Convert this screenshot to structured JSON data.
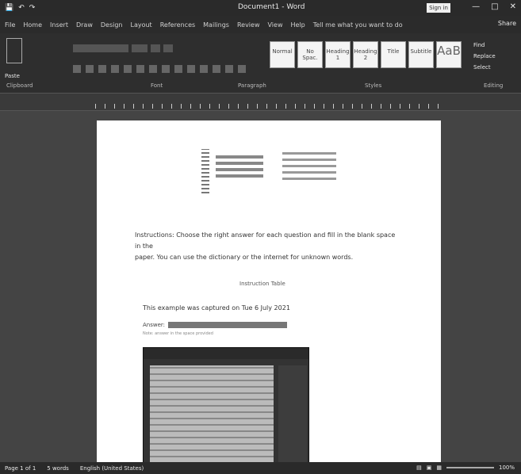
{
  "titlebar": {
    "qa_save": "save",
    "qa_undo": "↶",
    "qa_redo": "↷",
    "doc_title": "Document1 - Word",
    "signin": "Sign in",
    "min": "—",
    "max": "□",
    "close": "✕"
  },
  "menu": {
    "tabs": [
      "File",
      "Home",
      "Insert",
      "Draw",
      "Design",
      "Layout",
      "References",
      "Mailings",
      "Review",
      "View",
      "Help"
    ],
    "tell_me": "Tell me what you want to do",
    "share": "Share"
  },
  "ribbon": {
    "paste": "Paste",
    "clipboard": "Clipboard",
    "groups": [
      "Clipboard",
      "Font",
      "Paragraph",
      "Styles",
      "Editing"
    ],
    "styles": [
      "Normal",
      "No Spac.",
      "Heading 1",
      "Heading 2",
      "Title",
      "Subtitle",
      "AaB"
    ],
    "editing": [
      "Find",
      "Replace",
      "Select"
    ]
  },
  "doc": {
    "para1": "Instructions: Choose the right answer for each question and fill in the blank space in the",
    "para2": "paper. You can use the dictionary or the internet for unknown words.",
    "caption": "Instruction Table",
    "subhead": "This example was captured on Tue 6 July 2021",
    "field_label": "Answer:",
    "small": "Note: answer in the space provided"
  },
  "status": {
    "page": "Page 1 of 1",
    "words": "5 words",
    "lang": "English (United States)",
    "zoom": "100%"
  }
}
